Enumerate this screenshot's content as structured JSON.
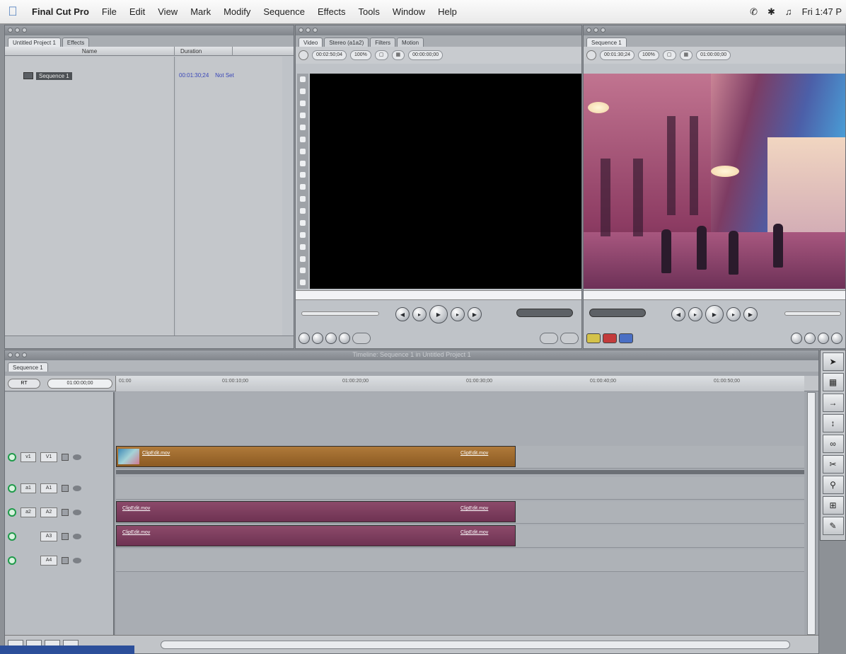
{
  "menubar": {
    "app": "Final Cut Pro",
    "items": [
      "File",
      "Edit",
      "View",
      "Mark",
      "Modify",
      "Sequence",
      "Effects",
      "Tools",
      "Window",
      "Help"
    ],
    "clock": "Fri 1:47 P"
  },
  "browser": {
    "tabs": [
      "Untitled Project 1",
      "Effects"
    ],
    "columns": {
      "name": "Name",
      "duration": "Duration"
    },
    "item": {
      "name": "Sequence 1",
      "duration": "00:01:30;24",
      "extra": "Not Set"
    }
  },
  "viewer": {
    "tabs": [
      "Video",
      "Stereo (a1a2)",
      "Filters",
      "Motion"
    ],
    "timecode_duration": "00:02:50;04",
    "timecode_current": "00:00:00;00",
    "zoom": "100%"
  },
  "canvas": {
    "tabs": [
      "Sequence 1"
    ],
    "timecode_duration": "00:01:30;24",
    "timecode_current": "01:00:00;00",
    "zoom": "100%"
  },
  "timeline": {
    "title": "Timeline: Sequence 1 in Untitled Project 1",
    "tabs": [
      "Sequence 1"
    ],
    "rt_label": "RT",
    "current_tc": "01:00:00;00",
    "ruler_ticks": [
      "01:00",
      "01:00:10;00",
      "01:00:20;00",
      "01:00:30;00",
      "01:00:40;00",
      "01:00:50;00"
    ],
    "tracks": [
      {
        "src": "v1",
        "dst": "V1",
        "clip": "ClipEdit.mov",
        "clip_end": "ClipEdit.mov",
        "type": "video"
      },
      {
        "src": "a1",
        "dst": "A1",
        "type": "empty"
      },
      {
        "src": "a2",
        "dst": "A2",
        "clip": "ClipEdit.mov",
        "clip_end": "ClipEdit.mov",
        "type": "audio"
      },
      {
        "src": "",
        "dst": "A3",
        "clip": "ClipEdit.mov",
        "clip_end": "ClipEdit.mov",
        "type": "audio"
      },
      {
        "src": "",
        "dst": "A4",
        "type": "empty"
      }
    ]
  },
  "colors": {
    "video_clip": "#9a6a2e",
    "audio_clip": "#7d3d5e",
    "accent": "#3a6fb8"
  }
}
